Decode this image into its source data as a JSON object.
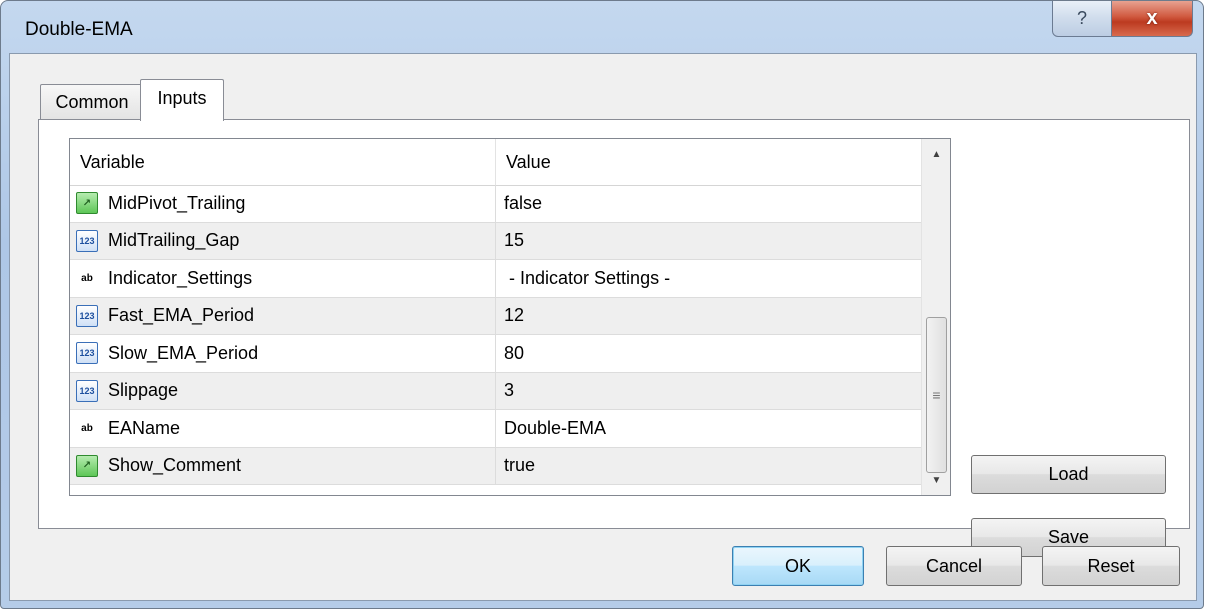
{
  "window": {
    "title": "Double-EMA",
    "help_glyph": "?",
    "close_glyph": "x"
  },
  "tabs": [
    {
      "label": "Common",
      "active": false
    },
    {
      "label": "Inputs",
      "active": true
    }
  ],
  "grid": {
    "columns": [
      "Variable",
      "Value"
    ],
    "rows": [
      {
        "type": "bool",
        "icon": "boolean-icon",
        "variable": "MidPivot_Trailing",
        "value": "false"
      },
      {
        "type": "int",
        "icon": "integer-icon",
        "variable": "MidTrailing_Gap",
        "value": "15"
      },
      {
        "type": "string",
        "icon": "string-icon",
        "variable": "Indicator_Settings",
        "value": " - Indicator Settings -"
      },
      {
        "type": "int",
        "icon": "integer-icon",
        "variable": "Fast_EMA_Period",
        "value": "12"
      },
      {
        "type": "int",
        "icon": "integer-icon",
        "variable": "Slow_EMA_Period",
        "value": "80"
      },
      {
        "type": "int",
        "icon": "integer-icon",
        "variable": "Slippage",
        "value": "3"
      },
      {
        "type": "string",
        "icon": "string-icon",
        "variable": "EAName",
        "value": "Double-EMA"
      },
      {
        "type": "bool",
        "icon": "boolean-icon",
        "variable": "Show_Comment",
        "value": "true"
      }
    ],
    "icon_glyphs": {
      "int": "123",
      "string": "ab",
      "bool": "↗"
    }
  },
  "side_buttons": {
    "load": "Load",
    "save": "Save"
  },
  "footer_buttons": {
    "ok": "OK",
    "cancel": "Cancel",
    "reset": "Reset"
  }
}
